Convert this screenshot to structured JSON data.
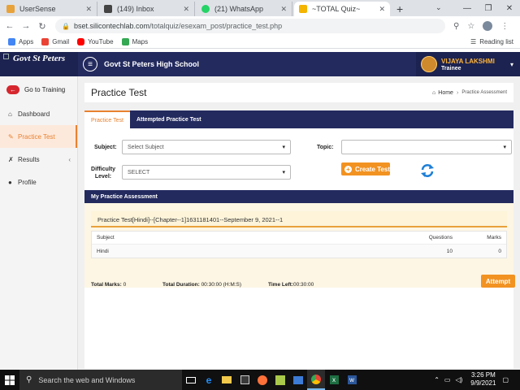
{
  "browser": {
    "tabs": [
      {
        "title": "UserSense",
        "favicon_color": "#e8a23a",
        "active": false
      },
      {
        "title": "(149) Inbox",
        "favicon_color": "#444444",
        "active": false
      },
      {
        "title": "(21) WhatsApp",
        "favicon_color": "#25d366",
        "active": false
      },
      {
        "title": "~TOTAL Quiz~",
        "favicon_color": "#f4b400",
        "active": true
      }
    ],
    "new_tab": "+",
    "url_domain": "bset.silicontechlab.com",
    "url_path": "/totalquiz/esexam_post/practice_test.php",
    "bookmarks": [
      {
        "label": "Apps",
        "color": "#4285f4"
      },
      {
        "label": "Gmail",
        "color": "#ea4335"
      },
      {
        "label": "YouTube",
        "color": "#ff0000"
      },
      {
        "label": "Maps",
        "color": "#34a853"
      }
    ],
    "reading_list": "Reading list"
  },
  "header": {
    "brand": "Govt St Peters",
    "school": "Govt St Peters High School",
    "user_name": "VIJAYA LAKSHMI",
    "user_role": "Trainee"
  },
  "sidebar": {
    "go_to_training": "Go to Training",
    "items": [
      {
        "label": "Dashboard",
        "icon": "dashboard-icon",
        "active": false,
        "arrow": ""
      },
      {
        "label": "Practice Test",
        "icon": "edit-icon",
        "active": true,
        "arrow": ""
      },
      {
        "label": "Results",
        "icon": "wrench-icon",
        "active": false,
        "arrow": "‹"
      },
      {
        "label": "Profile",
        "icon": "user-icon",
        "active": false,
        "arrow": ""
      }
    ]
  },
  "page": {
    "title": "Practice Test",
    "breadcrumb_home": "Home",
    "breadcrumb_current": "Practice Assessment",
    "tabs": [
      "Practice Test",
      "Attempted Practice Test"
    ],
    "subject_label": "Subject:",
    "subject_value": "Select Subject",
    "topic_label": "Topic:",
    "topic_value": "",
    "difficulty_label": "Difficulty Level:",
    "difficulty_value": "SELECT",
    "create_button": "Create Test",
    "assessment": {
      "heading": "My Practice Assessment",
      "test_title": "Practice Test[Hindi]--[Chapter--1]1631181401--September 9, 2021--1",
      "columns": [
        "Subject",
        "Questions",
        "Marks"
      ],
      "rows": [
        {
          "subject": "Hindi",
          "questions": "10",
          "marks": "0"
        }
      ],
      "total_marks_label": "Total Marks:",
      "total_marks": "0",
      "total_duration_label": "Total Duration:",
      "total_duration": "00:30:00 (H:M:S)",
      "time_left_label": "Time Left:",
      "time_left": "00:30:00",
      "attempt_button": "Attempt"
    }
  },
  "taskbar": {
    "search_text": "Search the web and Windows",
    "time": "3:26 PM",
    "date": "9/9/2021"
  }
}
